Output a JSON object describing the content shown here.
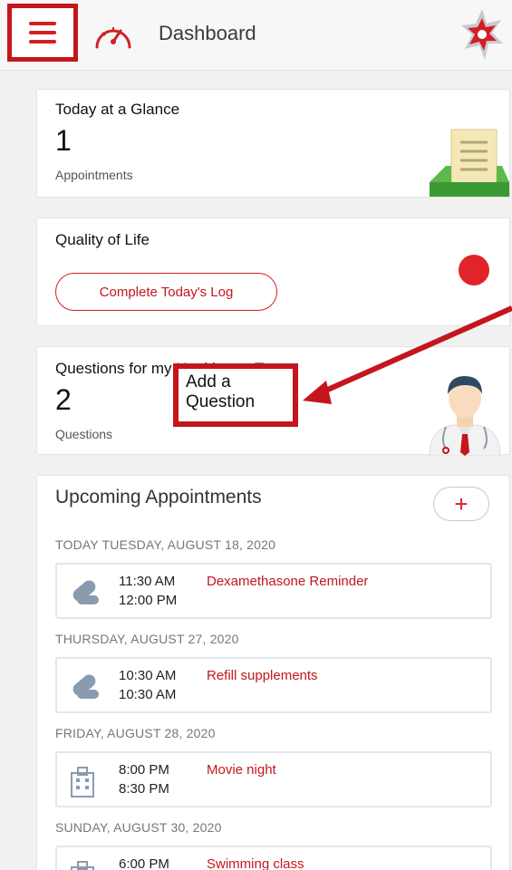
{
  "header": {
    "title": "Dashboard",
    "menu_icon": "hamburger-menu-icon",
    "gauge_icon": "speedometer-icon",
    "logo": "app-logo"
  },
  "glance": {
    "title": "Today at a Glance",
    "count": "1",
    "label": "Appointments"
  },
  "quality": {
    "title": "Quality of Life",
    "button": "Complete Today's Log",
    "status_color": "#e0242a"
  },
  "questions": {
    "title": "Questions for my Healthcare Team",
    "count": "2",
    "label": "Questions",
    "add_button_line1": "Add a",
    "add_button_line2": "Question"
  },
  "upcoming": {
    "title": "Upcoming Appointments",
    "add_label": "+",
    "groups": [
      {
        "date": "TODAY TUESDAY, AUGUST 18, 2020",
        "items": [
          {
            "start": "11:30 AM",
            "end": "12:00 PM",
            "name": "Dexamethasone Reminder",
            "icon": "pill-icon"
          }
        ]
      },
      {
        "date": "THURSDAY, AUGUST 27, 2020",
        "items": [
          {
            "start": "10:30 AM",
            "end": "10:30 AM",
            "name": "Refill supplements",
            "icon": "pill-icon"
          }
        ]
      },
      {
        "date": "FRIDAY, AUGUST 28, 2020",
        "items": [
          {
            "start": "8:00 PM",
            "end": "8:30 PM",
            "name": "Movie night",
            "icon": "building-icon"
          }
        ]
      },
      {
        "date": "SUNDAY, AUGUST 30, 2020",
        "items": [
          {
            "start": "6:00 PM",
            "end": "",
            "name": "Swimming class",
            "icon": "building-icon"
          }
        ]
      }
    ]
  },
  "colors": {
    "accent": "#c4161c",
    "highlight_box": "#c4161c"
  }
}
